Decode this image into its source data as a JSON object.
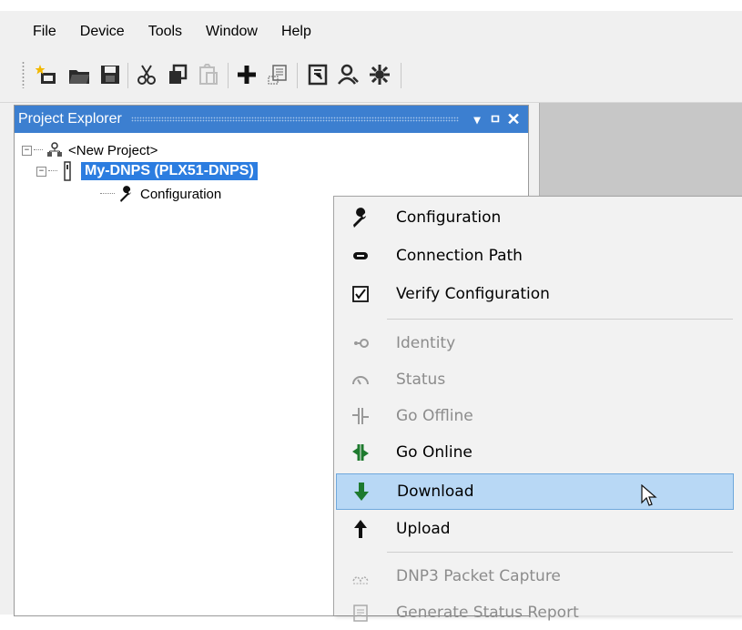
{
  "menubar": {
    "items": [
      "File",
      "Device",
      "Tools",
      "Window",
      "Help"
    ]
  },
  "toolbar": {
    "buttons": [
      "new-project-icon",
      "open-icon",
      "save-icon",
      "cut-icon",
      "copy-icon",
      "paste-icon",
      "add-device-icon",
      "properties-icon",
      "report-icon",
      "user-icon",
      "settings-network-icon"
    ]
  },
  "explorer": {
    "title": "Project Explorer",
    "tree": {
      "root": "<New Project>",
      "device": "My-DNPS (PLX51-DNPS)",
      "child": "Configuration"
    }
  },
  "context_menu": {
    "items": [
      {
        "label": "Configuration",
        "icon": "wrench-icon",
        "enabled": true
      },
      {
        "label": "Connection Path",
        "icon": "link-icon",
        "enabled": true
      },
      {
        "label": "Verify Configuration",
        "icon": "checkbox-icon",
        "enabled": true
      },
      {
        "label": "Identity",
        "icon": "identity-icon",
        "enabled": false
      },
      {
        "label": "Status",
        "icon": "status-icon",
        "enabled": false
      },
      {
        "label": "Go Offline",
        "icon": "go-offline-icon",
        "enabled": false
      },
      {
        "label": "Go Online",
        "icon": "go-online-icon",
        "enabled": true
      },
      {
        "label": "Download",
        "icon": "download-arrow-icon",
        "enabled": true,
        "hovered": true
      },
      {
        "label": "Upload",
        "icon": "upload-arrow-icon",
        "enabled": true
      },
      {
        "label": "DNP3 Packet Capture",
        "icon": "packet-capture-icon",
        "enabled": false
      },
      {
        "label": "Generate Status Report",
        "icon": "report-icon",
        "enabled": false
      }
    ]
  },
  "colors": {
    "title_bar": "#3c7fd0",
    "selection": "#2c7de0",
    "menu_hover": "#b8d8f5",
    "download_green": "#1e7a2e"
  }
}
